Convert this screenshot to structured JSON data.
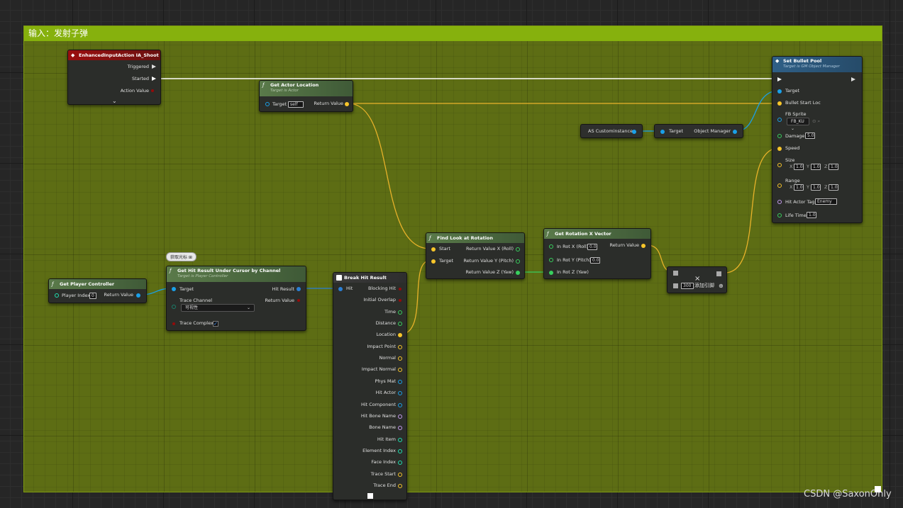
{
  "comment": {
    "title": "输入：发射子弹"
  },
  "nodes": {
    "input_action": {
      "title": "EnhancedInputAction IA_Shoot",
      "triggered": "Triggered",
      "started": "Started",
      "action_value": "Action Value",
      "expand": "⌄"
    },
    "get_actor_location": {
      "title": "Get Actor Location",
      "subtitle": "Target is Actor",
      "target": "Target",
      "target_value": "self",
      "return": "Return Value"
    },
    "set_bullet_pool": {
      "title": "Set Bullet Pool",
      "subtitle": "Target is GM Object Manager",
      "target": "Target",
      "bullet_start_loc": "Bullet Start Loc",
      "fb_sprite": "FB Sprite",
      "fb_sprite_value": "FB_KU",
      "damage": "Damage",
      "damage_value": "5.0",
      "speed": "Speed",
      "size": "Size",
      "size_x": "1.0",
      "size_y": "1.0",
      "size_z": "1.0",
      "range": "Range",
      "range_x": "1.0",
      "range_y": "1.0",
      "range_z": "1.0",
      "hit_actor_tag": "Hit Actor Tag",
      "hit_actor_tag_value": "Enemy",
      "life_time": "Life Time",
      "life_time_value": "1.0",
      "x": "X",
      "y": "Y",
      "z": "Z"
    },
    "as_custom": {
      "label": "AS Custominstance"
    },
    "object_manager": {
      "target": "Target",
      "return": "Object Manager"
    },
    "get_player_controller": {
      "title": "Get Player Controller",
      "player_index": "Player Index",
      "player_index_value": "0",
      "return": "Return Value"
    },
    "get_hit_result": {
      "title": "Get Hit Result Under Cursor by Channel",
      "subtitle": "Target is Player Controller",
      "tooltip": "获取光标",
      "target": "Target",
      "trace_channel": "Trace Channel",
      "trace_channel_value": "可视性",
      "trace_complex": "Trace Complex",
      "hit_result": "Hit Result",
      "return": "Return Value"
    },
    "break_hit": {
      "title": "Break Hit Result",
      "hit": "Hit",
      "outputs": [
        "Blocking Hit",
        "Initial Overlap",
        "Time",
        "Distance",
        "Location",
        "Impact Point",
        "Normal",
        "Impact Normal",
        "Phys Mat",
        "Hit Actor",
        "Hit Component",
        "Hit Bone Name",
        "Bone Name",
        "Hit Item",
        "Element Index",
        "Face Index",
        "Trace Start",
        "Trace End"
      ]
    },
    "find_look_at": {
      "title": "Find Look at Rotation",
      "start": "Start",
      "target": "Target",
      "ret_x": "Return Value X (Roll)",
      "ret_y": "Return Value Y (Pitch)",
      "ret_z": "Return Value Z (Yaw)"
    },
    "get_rotation_x": {
      "title": "Get Rotation X Vector",
      "in_x": "In Rot X (Roll)",
      "in_x_value": "0.0",
      "in_y": "In Rot Y (Pitch)",
      "in_y_value": "0.0",
      "in_z": "In Rot Z (Yaw)",
      "return": "Return Value"
    },
    "multiply": {
      "symbol": "×",
      "value": "300",
      "add_pin": "添加引脚"
    }
  },
  "watermark": "CSDN @SaxonOnly",
  "colors": {
    "exec": "#ffffff",
    "vector": "#f7c52a",
    "object": "#1aa0e8",
    "float": "#38d05e",
    "struct": "#2a7fd6",
    "bool": "#940b0b",
    "name": "#c69cf0",
    "int": "#1fe0b0"
  }
}
